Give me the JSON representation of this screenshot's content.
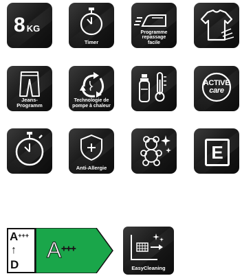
{
  "features": {
    "capacity": {
      "number": "8",
      "unit": "KG"
    },
    "timer": {
      "label": "Timer"
    },
    "iron": {
      "label": "Programme\nrepassage\nfacile"
    },
    "shirt": {
      "label": ""
    },
    "jeans": {
      "label": "Jeans-\nProgramm"
    },
    "heatpump": {
      "label": "Technologie de\npompe à chaleur"
    },
    "thermo": {
      "label": ""
    },
    "activecare": {
      "line1": "ACTIVE",
      "line2": "care"
    },
    "stopwatch": {
      "label": ""
    },
    "antiallergy": {
      "label": "Anti-Allergie"
    },
    "teddy": {
      "label": ""
    },
    "energy_letter": {
      "label": "E"
    },
    "easycleaning": {
      "label": "EasyCleaning"
    }
  },
  "energy_label": {
    "scale_top": "A",
    "scale_top_sup": "+++",
    "scale_arrow": "↑",
    "scale_bottom": "D",
    "class": "A",
    "class_sup": "+++",
    "arrow_color": "#1aa64a"
  }
}
